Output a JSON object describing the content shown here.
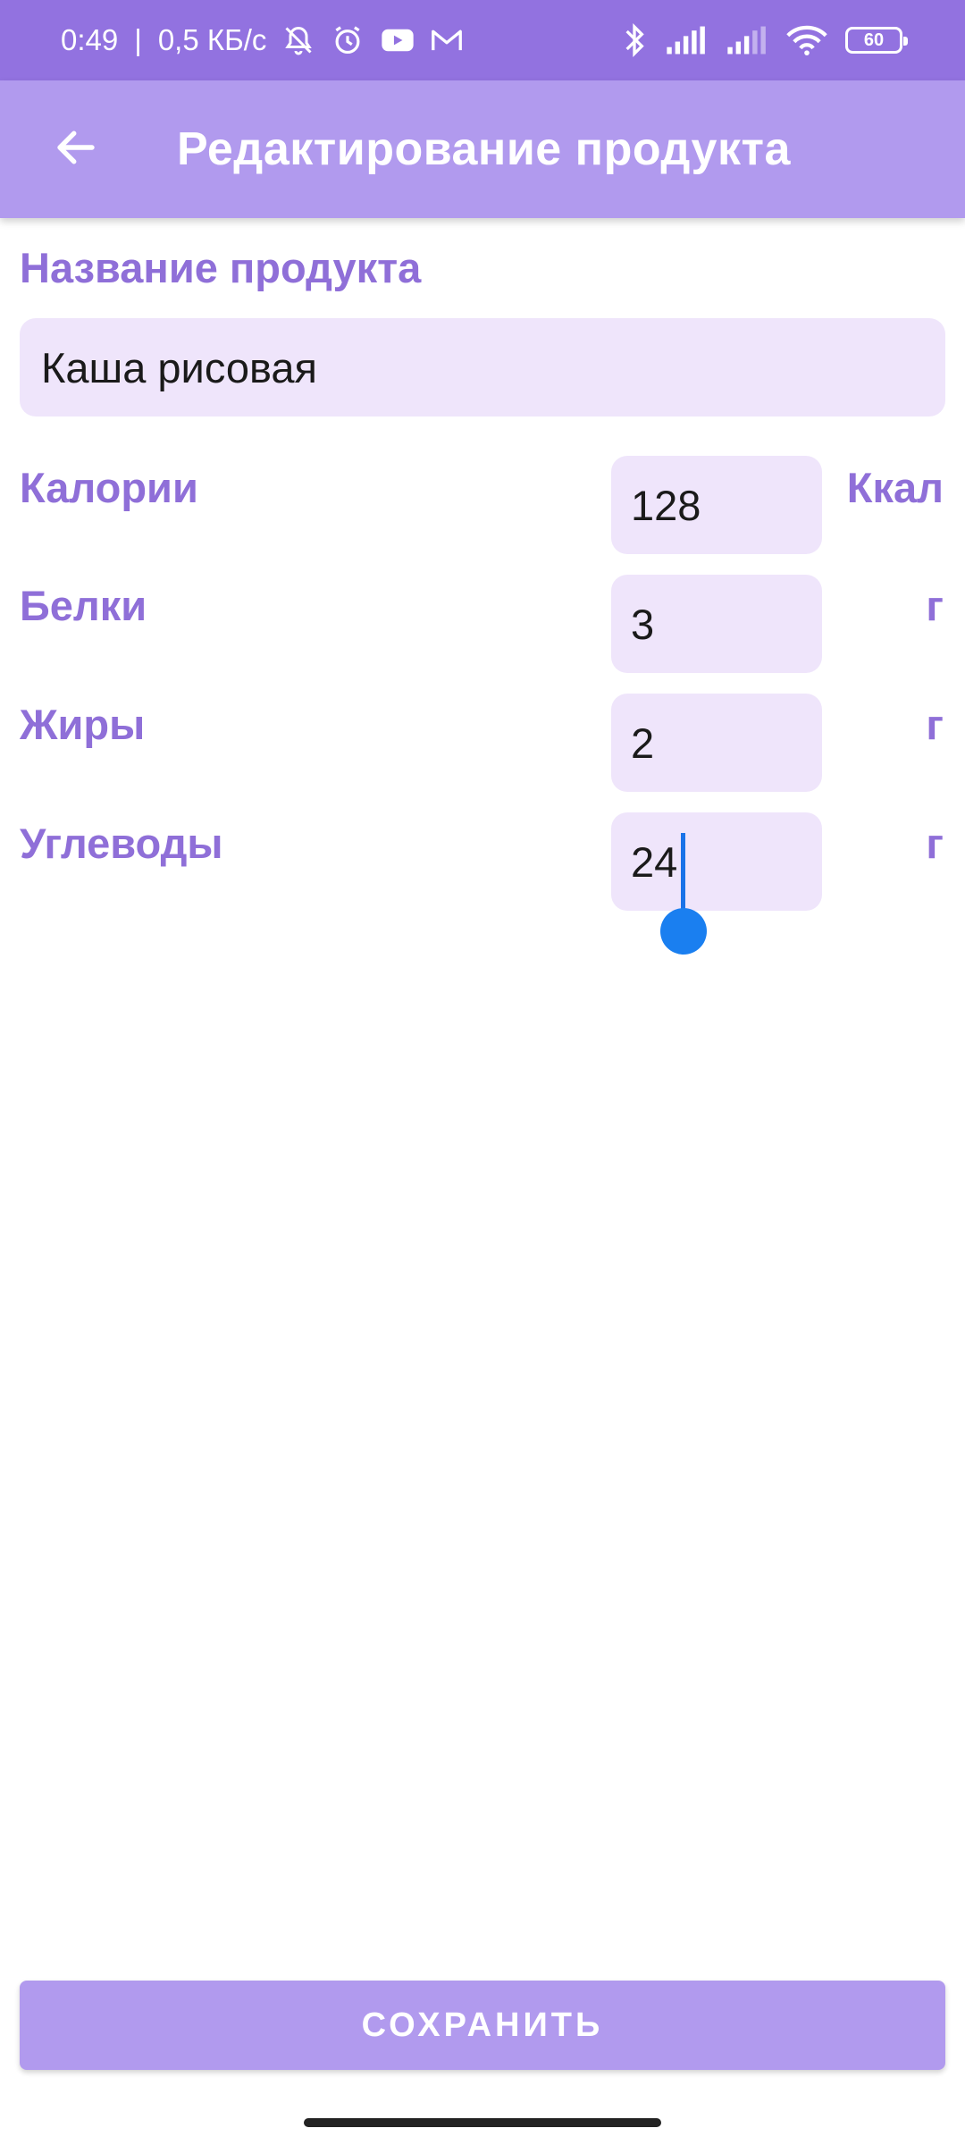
{
  "status_bar": {
    "time": "0:49",
    "separator": "|",
    "speed": "0,5 КБ/с",
    "battery": "60",
    "icons": [
      "bell-off-icon",
      "alarm-icon",
      "youtube-icon",
      "gmail-icon",
      "bluetooth-icon",
      "signal-icon",
      "signal-icon",
      "wifi-icon",
      "battery-icon"
    ]
  },
  "app_bar": {
    "title": "Редактирование продукта",
    "back_icon": "arrow-left-icon"
  },
  "form": {
    "name_label": "Название продукта",
    "name_value": "Каша рисовая",
    "fields": [
      {
        "label": "Калории",
        "value": "128",
        "unit": "Ккал"
      },
      {
        "label": "Белки",
        "value": "3",
        "unit": "г"
      },
      {
        "label": "Жиры",
        "value": "2",
        "unit": "г"
      },
      {
        "label": "Углеводы",
        "value": "24",
        "unit": "г"
      }
    ]
  },
  "save_button": {
    "label": "СОХРАНИТЬ"
  },
  "colors": {
    "status_bar": "#9272e0",
    "app_bar": "#b19aee",
    "accent_text": "#8f6fd8",
    "input_bg": "#efe5fb",
    "caret": "#1a73e8"
  }
}
